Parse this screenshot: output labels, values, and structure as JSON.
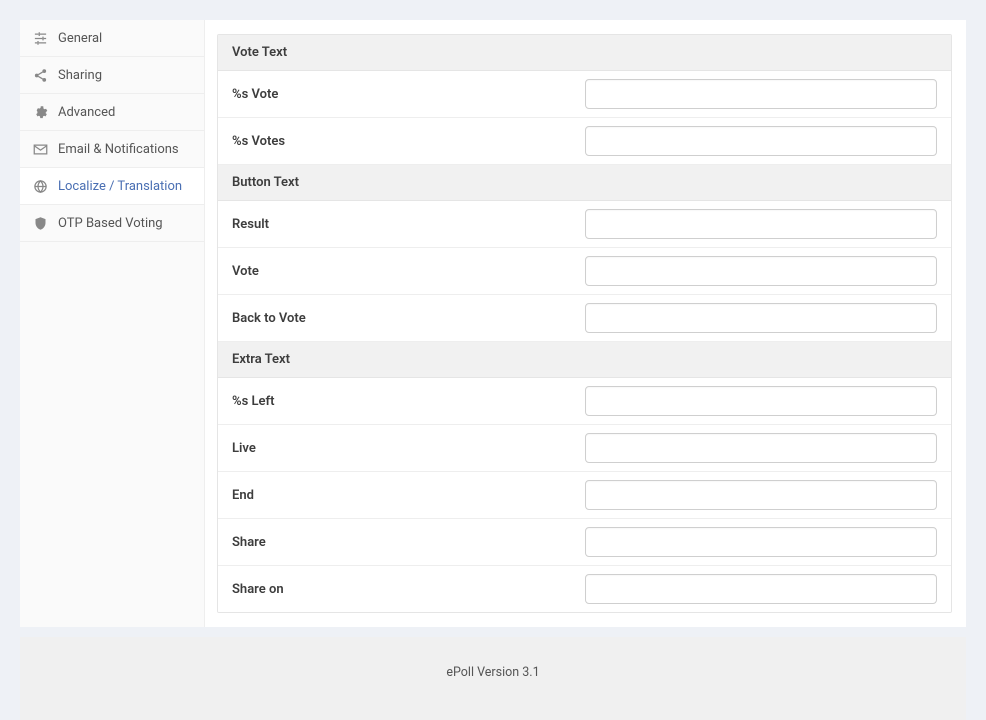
{
  "sidebar": {
    "items": [
      {
        "label": "General"
      },
      {
        "label": "Sharing"
      },
      {
        "label": "Advanced"
      },
      {
        "label": "Email & Notifications"
      },
      {
        "label": "Localize / Translation"
      },
      {
        "label": "OTP Based Voting"
      }
    ]
  },
  "sections": [
    {
      "header": "Vote Text",
      "fields": [
        {
          "label": "%s Vote",
          "value": ""
        },
        {
          "label": "%s Votes",
          "value": ""
        }
      ]
    },
    {
      "header": "Button Text",
      "fields": [
        {
          "label": "Result",
          "value": ""
        },
        {
          "label": "Vote",
          "value": ""
        },
        {
          "label": "Back to Vote",
          "value": ""
        }
      ]
    },
    {
      "header": "Extra Text",
      "fields": [
        {
          "label": "%s Left",
          "value": ""
        },
        {
          "label": "Live",
          "value": ""
        },
        {
          "label": "End",
          "value": ""
        },
        {
          "label": "Share",
          "value": ""
        },
        {
          "label": "Share on",
          "value": ""
        }
      ]
    }
  ],
  "footer": {
    "text": "ePoll Version 3.1"
  }
}
